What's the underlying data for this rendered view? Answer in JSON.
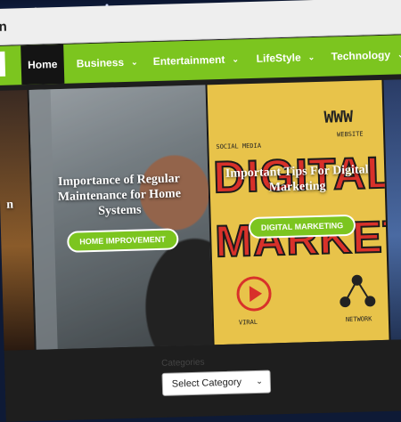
{
  "window": {
    "title_fragment": "n"
  },
  "nav": {
    "home": "Home",
    "items": [
      {
        "label": "Business"
      },
      {
        "label": "Entertainment"
      },
      {
        "label": "LifeStyle"
      },
      {
        "label": "Technology"
      }
    ],
    "chevron": "⌄"
  },
  "cards": [
    {
      "partial_text": "n",
      "image": "partial-lab-photo"
    },
    {
      "headline": "Importance of Regular Maintenance for Home Systems",
      "category": "HOME IMPROVEMENT",
      "image": "plumber-under-sink-photo"
    },
    {
      "headline": "Important Tips For Digital Marketing",
      "category": "DIGITAL MARKETING",
      "image": "digital-marketing-illustration",
      "illustration_text": {
        "line1": "DIGITAL",
        "line2": "MARKETIN",
        "www": "WWW",
        "social": "SOCIAL MEDIA",
        "website": "WEBSITE",
        "viral": "VIRAL",
        "network": "NETWORK"
      }
    },
    {
      "image": "partial-person-photo"
    }
  ],
  "footer": {
    "categories_label": "Categories",
    "select_value": "Select Category"
  },
  "colors": {
    "accent": "#7cc51f",
    "nav_home_bg": "#141414",
    "page_bg": "#1e1e1e"
  }
}
